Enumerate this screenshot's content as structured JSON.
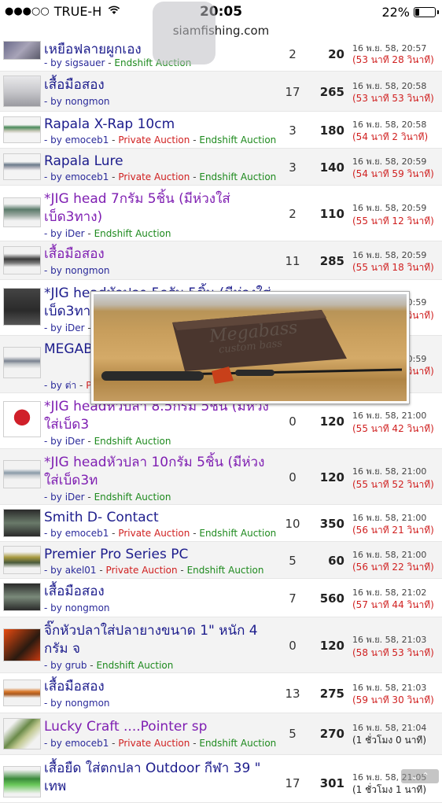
{
  "status_bar": {
    "carrier_dots": "●●●○○",
    "carrier": "TRUE-H",
    "time": "20:05",
    "battery": "22%",
    "battery_level": 0.22
  },
  "browser": {
    "url": "siamfishing.com"
  },
  "labels": {
    "by": "- by",
    "private": "Private Auction",
    "endshift": "Endshift Auction"
  },
  "rows": [
    {
      "title": "เหยือฟลายผูกเอง",
      "user": "sigsauer",
      "private": false,
      "endshift": true,
      "bids": "2",
      "price": "20",
      "time": "16 พ.ย. 58, 20:57",
      "remaining": "(53 นาที 28 วินาที)",
      "color": "blue"
    },
    {
      "title": "เสื้อมือสอง",
      "user": "nongmon",
      "private": false,
      "endshift": false,
      "bids": "17",
      "price": "265",
      "time": "16 พ.ย. 58, 20:58",
      "remaining": "(53 นาที 53 วินาที)",
      "color": "blue"
    },
    {
      "title": "Rapala X-Rap 10cm",
      "user": "emoceb1",
      "private": true,
      "endshift": true,
      "bids": "3",
      "price": "180",
      "time": "16 พ.ย. 58, 20:58",
      "remaining": "(54 นาที 2 วินาที)",
      "color": "blue"
    },
    {
      "title": "Rapala Lure",
      "user": "emoceb1",
      "private": true,
      "endshift": true,
      "bids": "3",
      "price": "140",
      "time": "16 พ.ย. 58, 20:59",
      "remaining": "(54 นาที 59 วินาที)",
      "color": "blue"
    },
    {
      "title": "*JIG head 7กรัม 5ชิ้น (มีห่วงใส่เบ็ด3ทาง)",
      "user": "iDer",
      "private": false,
      "endshift": true,
      "bids": "2",
      "price": "110",
      "time": "16 พ.ย. 58, 20:59",
      "remaining": "(55 นาที 12 วินาที)",
      "color": "purple"
    },
    {
      "title": "เสื้อมือสอง",
      "user": "nongmon",
      "private": false,
      "endshift": false,
      "bids": "11",
      "price": "285",
      "time": "16 พ.ย. 58, 20:59",
      "remaining": "(55 นาที 18 วินาที)",
      "color": "purple"
    },
    {
      "title": "*JIG headหัวปลา 5กรัม 5ชิ้น (มีห่วงใส่เบ็ด3ทาง",
      "user": "iDer",
      "private": false,
      "endshift": true,
      "bids": "",
      "price": "",
      "time": "16 พ.ย. 58, 20:59",
      "remaining": "(55 นาที 31 วินาที)",
      "color": "blue"
    },
    {
      "title": "MEGABASS F5- 510",
      "user": "ต่า",
      "private": true,
      "endshift": false,
      "bids": "",
      "price": "",
      "time": "16 พ.ย. 58, 20:59",
      "remaining": "(55 นาที 35 วินาที)",
      "color": "blue"
    },
    {
      "title": "*JIG headหัวปลา 8.5กรัม 5ชิ้น (มีห่วงใส่เบ็ด3",
      "user": "iDer",
      "private": false,
      "endshift": true,
      "bids": "0",
      "price": "120",
      "time": "16 พ.ย. 58, 21:00",
      "remaining": "(55 นาที 42 วินาที)",
      "color": "blue"
    },
    {
      "title": "*JIG headหัวปลา 10กรัม 5ชิ้น (มีห่วงใส่เบ็ด3ท",
      "user": "iDer",
      "private": false,
      "endshift": true,
      "bids": "0",
      "price": "120",
      "time": "16 พ.ย. 58, 21:00",
      "remaining": "(55 นาที 52 วินาที)",
      "color": "blue"
    },
    {
      "title": "Smith D- Contact",
      "user": "emoceb1",
      "private": true,
      "endshift": true,
      "bids": "10",
      "price": "350",
      "time": "16 พ.ย. 58, 21:00",
      "remaining": "(56 นาที 21 วินาที)",
      "color": "blue"
    },
    {
      "title": "Premier Pro Series PC",
      "user": "akel01",
      "private": true,
      "endshift": true,
      "bids": "5",
      "price": "60",
      "time": "16 พ.ย. 58, 21:00",
      "remaining": "(56 นาที 22 วินาที)",
      "color": "blue"
    },
    {
      "title": "เสื้อมือสอง",
      "user": "nongmon",
      "private": false,
      "endshift": false,
      "bids": "7",
      "price": "560",
      "time": "16 พ.ย. 58, 21:02",
      "remaining": "(57 นาที 44 วินาที)",
      "color": "blue"
    },
    {
      "title": "จิ๊กหัวปลาใส่ปลายางขนาด 1\" หนัก 4 กรัม จ",
      "user": "grub",
      "private": false,
      "endshift": true,
      "bids": "0",
      "price": "120",
      "time": "16 พ.ย. 58, 21:03",
      "remaining": "(58 นาที 53 วินาที)",
      "color": "blue"
    },
    {
      "title": "เสื้อมือสอง",
      "user": "nongmon",
      "private": false,
      "endshift": false,
      "bids": "13",
      "price": "275",
      "time": "16 พ.ย. 58, 21:03",
      "remaining": "(59 นาที 30 วินาที)",
      "color": "blue"
    },
    {
      "title": "Lucky Craft ....Pointer sp",
      "user": "emoceb1",
      "private": true,
      "endshift": true,
      "bids": "5",
      "price": "270",
      "time": "16 พ.ย. 58, 21:04",
      "remaining": "(1 ชั่วโมง 0 นาที)",
      "color": "purple"
    },
    {
      "title": "เสื้อยืด ใส่ตกปลา Outdoor กีฬา 39 \" เทพ",
      "user": "",
      "private": false,
      "endshift": false,
      "bids": "17",
      "price": "301",
      "time": "16 พ.ย. 58, 21:05",
      "remaining": "(1 ชั่วโมง 1 นาที)",
      "color": "blue"
    }
  ],
  "popup": {
    "bag_line1": "Megabass",
    "bag_line2": "custom bass"
  }
}
